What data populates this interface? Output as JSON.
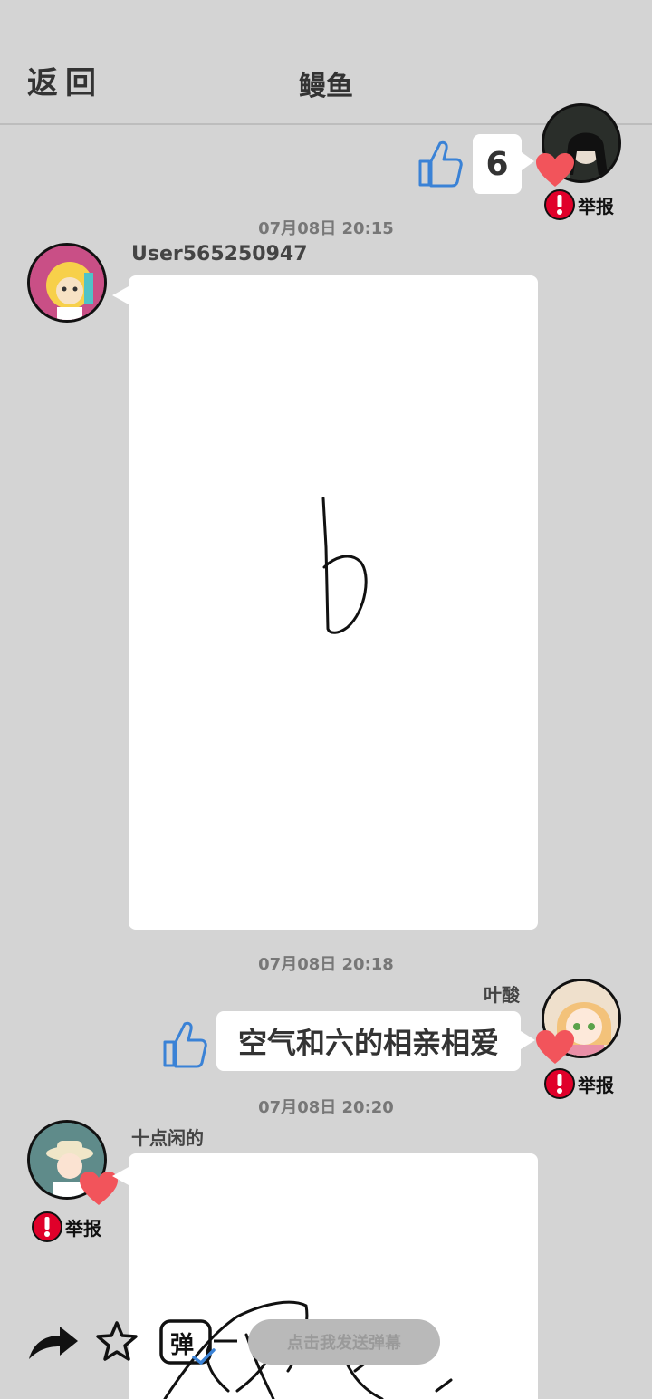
{
  "header": {
    "back_label": "返回",
    "title": "鳗鱼"
  },
  "messages": [
    {
      "side": "right",
      "type": "text",
      "text": "6",
      "liked": true,
      "report_label": "举报"
    },
    {
      "time": "07月08日  20:15",
      "side": "left",
      "username": "User565250947",
      "type": "drawing",
      "drawing_text": "b"
    },
    {
      "time": "07月08日  20:18",
      "side": "right",
      "username": "叶酸",
      "type": "text",
      "text": "空气和六的相亲相爱",
      "liked": true,
      "report_label": "举报"
    },
    {
      "time": "07月08日  20:20",
      "side": "left",
      "username": "十点闲的",
      "type": "drawing",
      "liked": true,
      "report_label": "举报"
    }
  ],
  "bottom": {
    "danmaku_placeholder": "点击我发送弹幕",
    "danmaku_toggle_label": "弹"
  },
  "colors": {
    "background": "#d4d4d4",
    "heart": "#f2545b",
    "report": "#e0002a",
    "like": "#3a82d6"
  }
}
